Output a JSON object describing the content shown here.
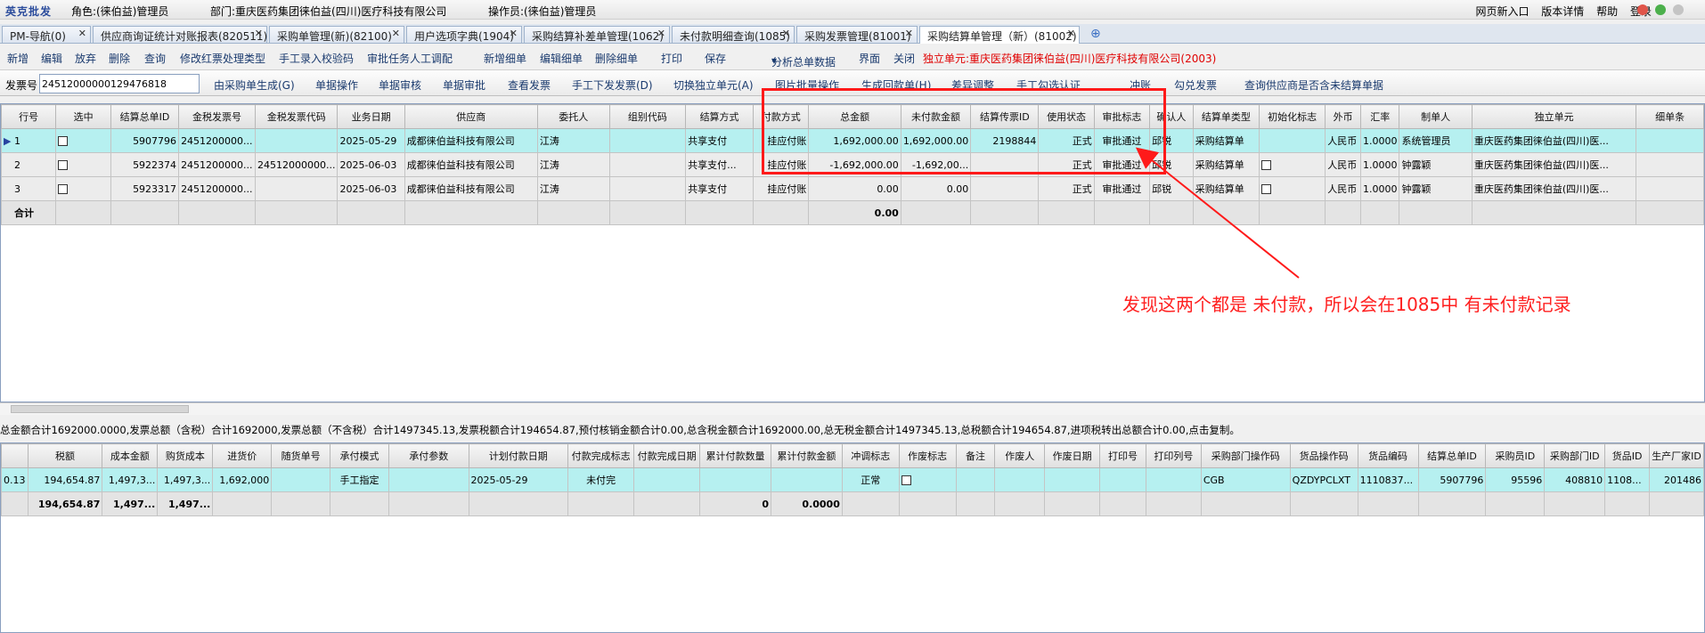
{
  "app": {
    "brand": "英克批发",
    "role": "角色:(徕伯益)管理员",
    "dept": "部门:重庆医药集团徕伯益(四川)医疗科技有限公司",
    "operator": "操作员:(徕伯益)管理员",
    "links": [
      "网页新入口",
      "版本详情",
      "帮助",
      "登录"
    ],
    "dot_colors": [
      "#e0554a",
      "#4cb04c",
      "#c4c4c4"
    ]
  },
  "tabs": [
    "PM-导航(0)",
    "供应商询证统计对账报表(820511)",
    "采购单管理(新)(82100)",
    "用户选项字典(1904)",
    "采购结算补差单管理(1062)",
    "未付款明细查询(1085)",
    "采购发票管理(81001)",
    "采购结算单管理（新）(81002)"
  ],
  "toolbar1": {
    "items": [
      "新增",
      "编辑",
      "放弃",
      "删除",
      "查询",
      "修改红票处理类型",
      "手工录入校验码",
      "审批任务人工调配",
      "新增细单",
      "编辑细单",
      "删除细单",
      "打印",
      "保存",
      "分析总单数据",
      "界面",
      "关闭"
    ],
    "unit": "独立单元:重庆医药集团徕伯益(四川)医疗科技有限公司(2003)"
  },
  "toolbar2": {
    "invoice_label": "发票号",
    "invoice_value": "2451200000012947681​8",
    "items": [
      "由采购单生成(G)",
      "单据操作",
      "单据审核",
      "单据审批",
      "查看发票",
      "手工下发发票(D)",
      "切换独立单元(A)",
      "图片批量操作",
      "生成回款单(H)",
      "差异调整",
      "手工勾选认证",
      "冲账",
      "勾兑发票",
      "查询供应商是否含未结算单据"
    ]
  },
  "master": {
    "headers": [
      "行号",
      "选中",
      "结算总单ID",
      "金税发票号",
      "金税发票代码",
      "业务日期",
      "供应商",
      "委托人",
      "组别代码",
      "结算方式",
      "付款方式",
      "总金额",
      "未付款金额",
      "结算传票ID",
      "使用状态",
      "审批标志",
      "确认人",
      "结算单类型",
      "初始化标志",
      "外币",
      "汇率",
      "制单人",
      "独立单元",
      "细单条"
    ],
    "rows": [
      [
        "1",
        "",
        "5907796",
        "2451200000...",
        "",
        "2025-05-29",
        "成都徕伯益科技有限公司",
        "江涛",
        "",
        "共享支付",
        "挂应付账",
        "1,692,000.00",
        "1,692,000.00",
        "2198844",
        "正式",
        "审批通过",
        "邱锐",
        "采购结算单",
        "",
        "人民币",
        "1.0000",
        "系统管理员",
        "重庆医药集团徕伯益(四川)医...",
        ""
      ],
      [
        "2",
        "",
        "5922374",
        "2451200000...",
        "24512000000...",
        "2025-06-03",
        "成都徕伯益科技有限公司",
        "江涛",
        "",
        "共享支付...",
        "挂应付账",
        "-1,692,000.00",
        "-1,692,00...",
        "",
        "正式",
        "审批通过",
        "邱锐",
        "采购结算单",
        "",
        "人民币",
        "1.0000",
        "钟露颖",
        "重庆医药集团徕伯益(四川)医...",
        ""
      ],
      [
        "3",
        "",
        "5923317",
        "2451200000...",
        "",
        "2025-06-03",
        "成都徕伯益科技有限公司",
        "江涛",
        "",
        "共享支付",
        "挂应付账",
        "0.00",
        "0.00",
        "",
        "正式",
        "审批通过",
        "邱锐",
        "采购结算单",
        "",
        "人民币",
        "1.0000",
        "钟露颖",
        "重庆医药集团徕伯益(四川)医...",
        ""
      ]
    ],
    "total_label": "合计",
    "total_amount": "0.00"
  },
  "summary": "总金额合计1692000.0000,发票总额（含税）合计1692000,发票总额（不含税）合计1497345.13,发票税额合计194654.87,预付核销金额合计0.00,总含税金额合计1692000.00,总无税金额合计1497345.13,总税额合计194654.87,进项税转出总额合计0.00,点击复制。",
  "detail": {
    "headers": [
      "",
      "税额",
      "成本金额",
      "购货成本",
      "进货价",
      "随货单号",
      "承付模式",
      "承付参数",
      "计划付款日期",
      "付款完成标志",
      "付款完成日期",
      "累计付款数量",
      "累计付款金额",
      "冲调标志",
      "作废标志",
      "备注",
      "作废人",
      "作废日期",
      "打印号",
      "打印列号",
      "采购部门操作码",
      "货品操作码",
      "货品编码",
      "结算总单ID",
      "采购员ID",
      "采购部门ID",
      "货品ID",
      "生产厂家ID"
    ],
    "row": [
      "0.13",
      "194,654.87",
      "1,497,3...",
      "1,497,3...",
      "1,692,000",
      "",
      "手工指定",
      "",
      "2025-05-29",
      "未付完",
      "",
      "",
      "",
      "正常",
      "",
      "",
      "",
      "",
      "",
      "",
      "CGB",
      "QZDYPCLXT",
      "1110837...",
      "5907796",
      "95596",
      "408810",
      "1108...",
      "201486"
    ],
    "total": [
      "",
      "194,654.87",
      "1,497...",
      "1,497...",
      "",
      "",
      "",
      "",
      "",
      "",
      "",
      "0",
      "0.0000",
      "",
      "",
      "",
      "",
      "",
      "",
      "",
      "",
      "",
      "",
      "",
      "",
      "",
      "",
      ""
    ]
  },
  "annotation": "发现这两个都是 未付款，所以会在1085中 有未付款记录",
  "accent": "#ff1a1a"
}
